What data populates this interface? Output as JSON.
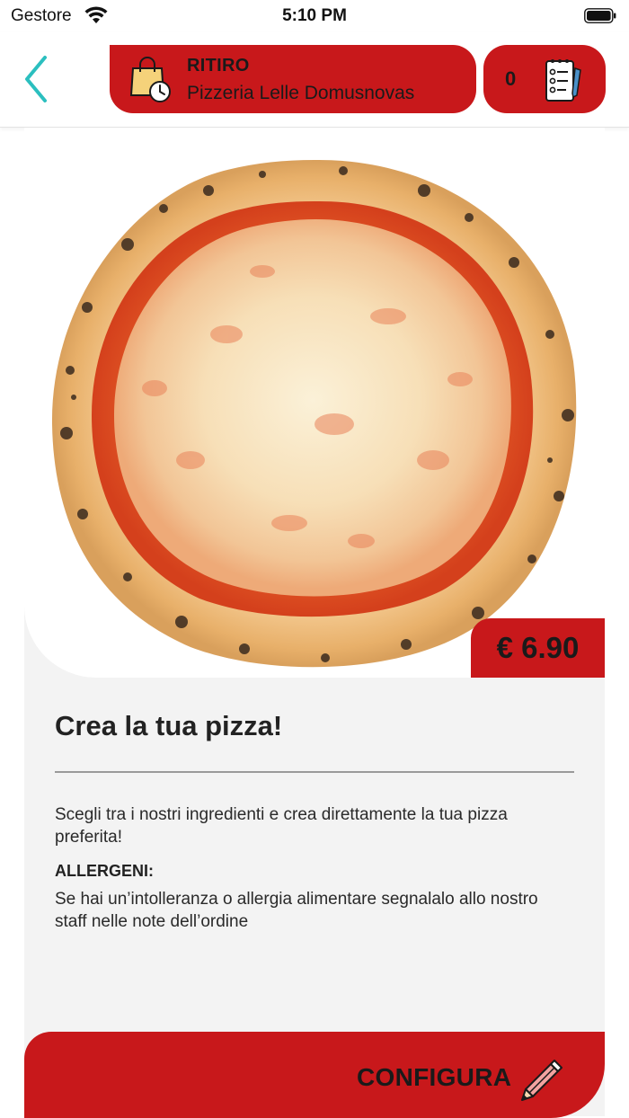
{
  "status_bar": {
    "carrier": "Gestore",
    "time": "5:10 PM"
  },
  "header": {
    "delivery_mode": "RITIRO",
    "store_name": "Pizzeria Lelle Domusnovas",
    "cart_count": "0"
  },
  "product": {
    "price": "€ 6.90",
    "title": "Crea la tua pizza!",
    "description": "Scegli tra i nostri ingredienti e crea direttamente la tua pizza preferita!",
    "allergens_label": "ALLERGENI:",
    "allergens_text": "Se hai un’intolleranza o allergia alimentare segnalalo allo nostro staff nelle note dell’ordine"
  },
  "actions": {
    "configure_label": "CONFIGURA"
  },
  "colors": {
    "brand_red": "#c8181b",
    "back_arrow": "#2bbfbf",
    "card_bg": "#f3f3f3"
  },
  "icons": {
    "back": "chevron-left-icon",
    "bag": "shopping-bag-clock-icon",
    "order": "order-list-icon",
    "configure": "pencil-icon"
  }
}
